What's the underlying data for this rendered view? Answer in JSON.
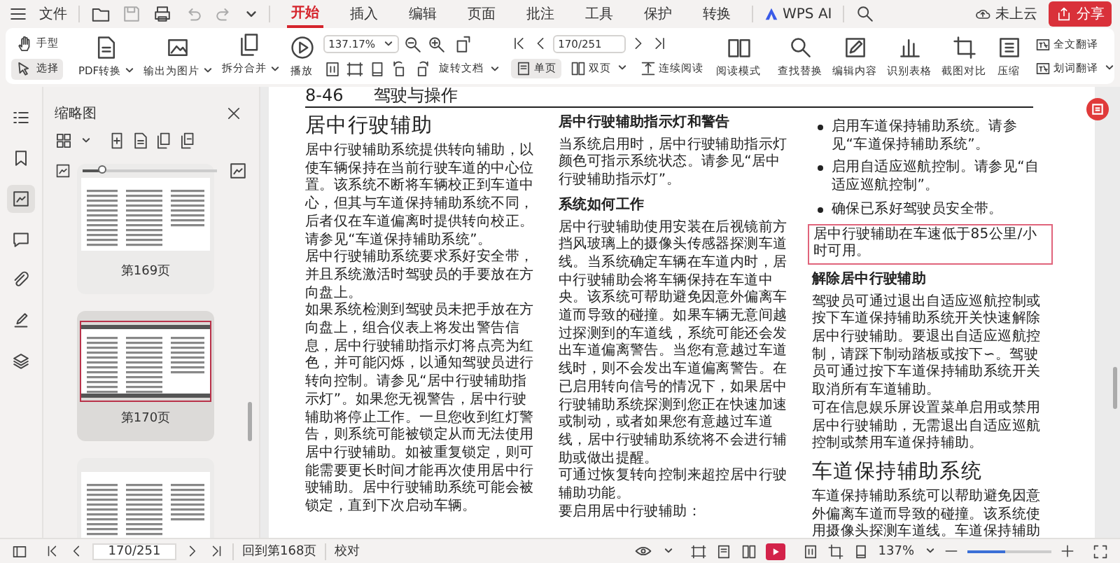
{
  "menu": {
    "label": "文件"
  },
  "tabs": [
    {
      "label": "开始",
      "selected": true
    },
    {
      "label": "插入",
      "selected": false
    },
    {
      "label": "编辑",
      "selected": false
    },
    {
      "label": "页面",
      "selected": false
    },
    {
      "label": "批注",
      "selected": false
    },
    {
      "label": "工具",
      "selected": false
    },
    {
      "label": "保护",
      "selected": false
    },
    {
      "label": "转换",
      "selected": false
    }
  ],
  "ai": {
    "label": "WPS AI"
  },
  "cloud": {
    "label": "未上云"
  },
  "share": {
    "label": "分享"
  },
  "ribbon": {
    "modes": [
      {
        "label": "手型",
        "selected": false
      },
      {
        "label": "选择",
        "selected": true
      }
    ],
    "tools": [
      {
        "label": "PDF转换",
        "dropdown": true
      },
      {
        "label": "输出为图片",
        "dropdown": true
      },
      {
        "label": "拆分合并",
        "dropdown": true
      },
      {
        "label": "播放",
        "dropdown": false
      }
    ],
    "zoom": {
      "value": "137.17%"
    },
    "rotate": {
      "label": "旋转文档",
      "dropdown": true
    },
    "page": {
      "value": "170/251"
    },
    "views": [
      {
        "label": "单页",
        "selected": true,
        "dropdown": false
      },
      {
        "label": "双页",
        "selected": false,
        "dropdown": true
      },
      {
        "label": "连续阅读",
        "selected": false,
        "dropdown": false
      }
    ],
    "reading": {
      "label": "阅读模式"
    },
    "tools2": [
      {
        "label": "查找替换"
      },
      {
        "label": "编辑内容"
      },
      {
        "label": "识别表格"
      },
      {
        "label": "截图对比"
      },
      {
        "label": "压缩"
      }
    ],
    "translate": [
      {
        "label": "全文翻译",
        "dropdown": false
      },
      {
        "label": "划词翻译",
        "dropdown": true
      }
    ]
  },
  "rail": [
    {
      "selected": false
    },
    {
      "selected": false
    },
    {
      "selected": true
    },
    {
      "selected": false
    },
    {
      "selected": false
    },
    {
      "selected": false
    },
    {
      "selected": false
    }
  ],
  "thumbnails": {
    "title": "缩略图",
    "level": 0.15,
    "pages": [
      {
        "label": "第169页",
        "selected": false
      },
      {
        "label": "第170页",
        "selected": true
      },
      {
        "selected": false
      }
    ]
  },
  "document": {
    "header": {
      "number": "8-46",
      "title": "驾驶与操作"
    },
    "columns": [
      [
        {
          "kind": "heading",
          "text": "居中行驶辅助"
        },
        {
          "kind": "para",
          "text": "居中行驶辅助系统提供转向辅助，以使车辆保持在当前行驶车道的中心位置。该系统不断将车辆校正到车道中心，但其与车道保持辅助系统不同，后者仅在车道偏离时提供转向校正。请参见“车道保持辅助系统”。"
        },
        {
          "kind": "para",
          "text": "居中行驶辅助系统要求系好安全带，并且系统激活时驾驶员的手要放在方向盘上。"
        },
        {
          "kind": "para",
          "text": "如果系统检测到驾驶员未把手放在方向盘上，组合仪表上将发出警告信息，居中行驶辅助指示灯将点亮为红色，并可能闪烁，以通知驾驶员进行转向控制。请参见“居中行驶辅助指示灯”。如果您无视警告，居中行驶辅助将停止工作。一旦您收到红灯警告，则系统可能被锁定从而无法使用居中行驶辅助。如被重复锁定，则可能需要更长时间才能再次使用居中行驶辅助。居中行驶辅助系统可能会被锁定，直到下次启动车辆。"
        }
      ],
      [
        {
          "kind": "subheading",
          "text": "居中行驶辅助指示灯和警告"
        },
        {
          "kind": "para",
          "text": "当系统启用时，居中行驶辅助指示灯颜色可指示系统状态。请参见“居中行驶辅助指示灯”。"
        },
        {
          "kind": "subheading",
          "text": "系统如何工作"
        },
        {
          "kind": "para",
          "text": "居中行驶辅助使用安装在后视镜前方挡风玻璃上的摄像头传感器探测车道线。当系统确定车辆在车道内时，居中行驶辅助会将车辆保持在车道中央。该系统可帮助避免因意外偏离车道而导致的碰撞。如果车辆无意间越过探测到的车道线，系统可能还会发出车道偏离警告。当您有意越过车道线时，则不会发出车道偏离警告。在已启用转向信号的情况下，如果居中行驶辅助系统探测到您正在快速加速或制动，或者如果您有意越过车道线，居中行驶辅助系统将不会进行辅助或做出提醒。"
        },
        {
          "kind": "para",
          "text": "可通过恢复转向控制来超控居中行驶辅助功能。"
        },
        {
          "kind": "para",
          "text": "要启用居中行驶辅助："
        }
      ],
      [
        {
          "kind": "bullet",
          "text": "启用车道保持辅助系统。请参见“车道保持辅助系统”。"
        },
        {
          "kind": "bullet",
          "text": "启用自适应巡航控制。请参见“自适应巡航控制”。"
        },
        {
          "kind": "bullet",
          "text": "确保已系好驾驶员安全带。"
        },
        {
          "kind": "note",
          "text": "居中行驶辅助在车速低于85公里/小时可用。"
        },
        {
          "kind": "subheading",
          "text": "解除居中行驶辅助"
        },
        {
          "kind": "para",
          "text": "驾驶员可通过退出自适应巡航控制或按下车道保持辅助系统开关快速解除居中行驶辅助。要退出自适应巡航控制，请踩下制动踏板或按下∽。驾驶员可通过按下车道保持辅助系统开关取消所有车道辅助。"
        },
        {
          "kind": "para",
          "text": "可在信息娱乐屏设置菜单启用或禁用居中行驶辅助，无需退出自适应巡航控制或禁用车道保持辅助。"
        },
        {
          "kind": "heading",
          "text": "车道保持辅助系统"
        },
        {
          "kind": "para",
          "text": "车道保持辅助系统可以帮助避免因意外偏离车道而导致的碰撞。该系统使用摄像头探测车道线。车道保持辅助"
        }
      ]
    ]
  },
  "status_bar": {
    "page": "170/251",
    "back": "回到第168页",
    "proofread": "校对",
    "zoom": "137%",
    "level": 0.45
  }
}
